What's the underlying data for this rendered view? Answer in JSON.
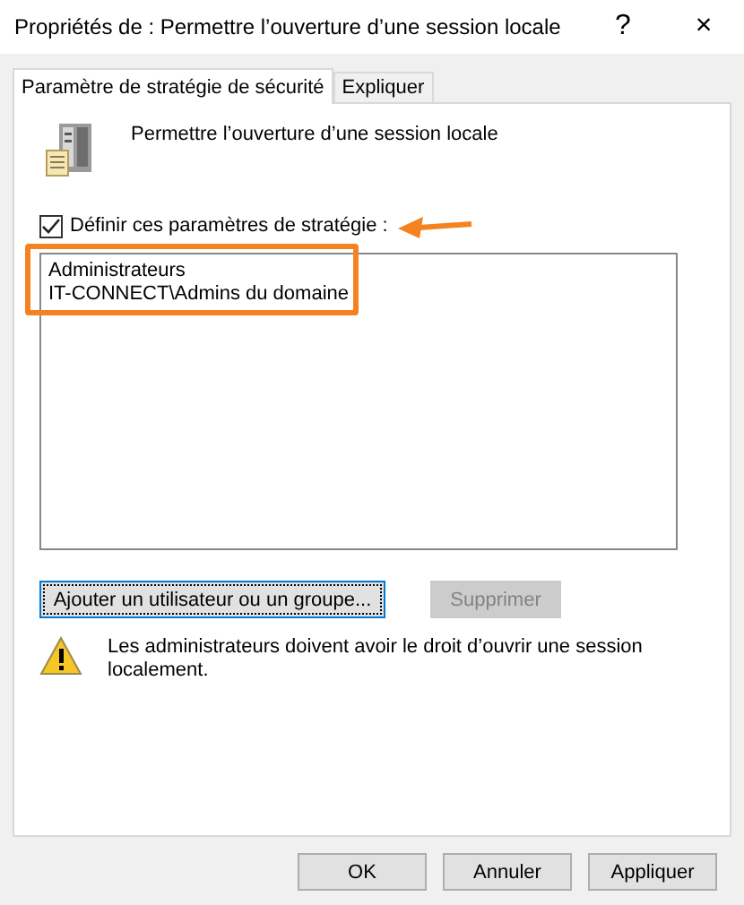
{
  "window": {
    "title": "Propriétés de : Permettre l’ouverture d’une session locale",
    "help": "?",
    "close": "×"
  },
  "tabs": [
    {
      "label": "Paramètre de stratégie de sécurité",
      "selected": true
    },
    {
      "label": "Expliquer",
      "selected": false
    }
  ],
  "policy": {
    "name": "Permettre l’ouverture d’une session locale"
  },
  "define_checkbox": {
    "label": "Définir ces paramètres de stratégie :",
    "checked": true
  },
  "members": [
    "Administrateurs",
    "IT-CONNECT\\Admins du domaine"
  ],
  "annotation": {
    "highlight": true,
    "arrow": true
  },
  "actions": [
    {
      "label": "Ajouter un utilisateur ou un groupe...",
      "disabled": false,
      "focused": true
    },
    {
      "label": "Supprimer",
      "disabled": true,
      "focused": false
    }
  ],
  "warning": "Les administrateurs doivent avoir le droit d’ouvrir une session localement.",
  "buttons": [
    {
      "label": "OK"
    },
    {
      "label": "Annuler"
    },
    {
      "label": "Appliquer"
    }
  ]
}
